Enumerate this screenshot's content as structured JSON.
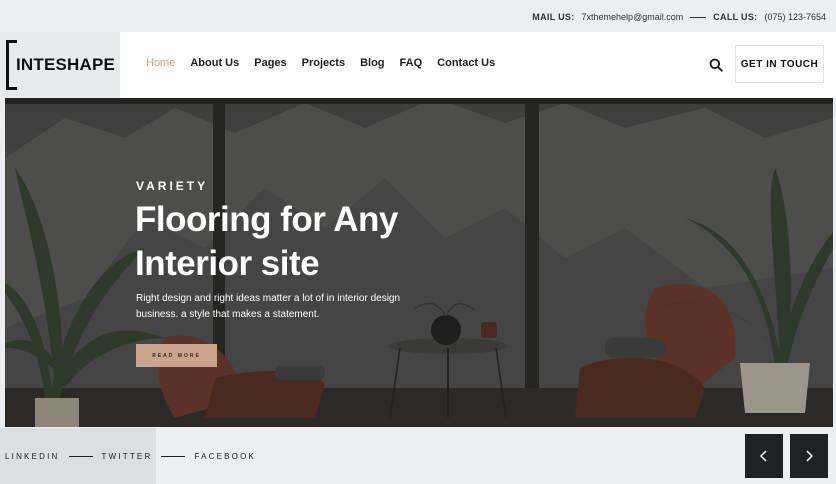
{
  "topbar": {
    "mail_label": "MAIL US:",
    "mail_value": "7xthemehelp@gmail.com",
    "call_label": "CALL US:",
    "call_value": "(075) 123-7654"
  },
  "header": {
    "logo_text": "INTESHAPE",
    "nav": [
      {
        "label": "Home",
        "active": true
      },
      {
        "label": "About Us"
      },
      {
        "label": "Pages"
      },
      {
        "label": "Projects"
      },
      {
        "label": "Blog"
      },
      {
        "label": "FAQ"
      },
      {
        "label": "Contact Us"
      }
    ],
    "cta_label": "GET IN TOUCH"
  },
  "hero": {
    "eyebrow": "VARIETY",
    "title_line1": "Flooring for Any",
    "title_line2": "Interior site",
    "desc_line1": "Right design and right ideas matter a lot of in interior design",
    "desc_line2": "business. a style that makes a statement.",
    "button_label": "READ MORE"
  },
  "social": {
    "items": [
      "LINKEDIN",
      "TWITTER",
      "FACEBOOK"
    ]
  },
  "slider": {
    "prev_icon": "chevron-left-icon",
    "next_icon": "chevron-right-icon"
  },
  "colors": {
    "accent": "#c9a48a",
    "dark": "#1f2224",
    "topbar_bg": "#eceeef"
  }
}
